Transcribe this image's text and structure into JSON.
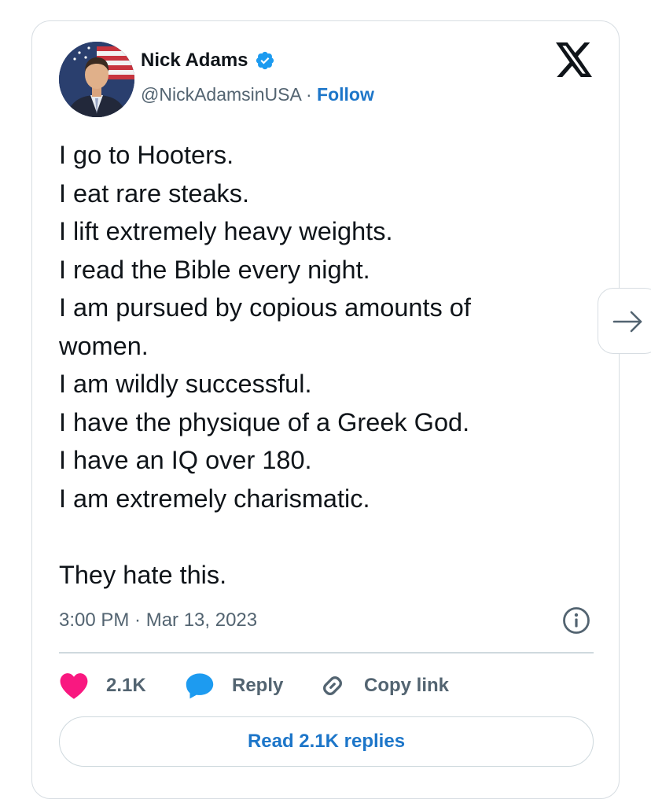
{
  "author": {
    "display_name": "Nick Adams",
    "handle": "@NickAdamsinUSA",
    "separator": "·",
    "follow_label": "Follow",
    "verified_icon": "verified-badge-icon"
  },
  "tweet": {
    "lines": [
      "I go to Hooters.",
      "I eat rare steaks.",
      "I lift extremely heavy weights.",
      "I read the Bible every night.",
      "I am pursued by copious amounts of",
      "women.",
      "I am wildly successful.",
      "I have the physique of a Greek God.",
      "I have an IQ over 180.",
      "I am extremely charismatic.",
      "",
      "They hate this."
    ],
    "timestamp": "3:00 PM · Mar 13, 2023"
  },
  "actions": {
    "like_count": "2.1K",
    "reply_label": "Reply",
    "copy_link_label": "Copy link"
  },
  "read_replies_label": "Read 2.1K replies",
  "icons": {
    "logo": "x-logo-icon",
    "info": "info-icon",
    "like": "heart-icon",
    "reply": "speech-bubble-icon",
    "copy": "link-icon",
    "next": "arrow-right-icon"
  },
  "colors": {
    "link_blue": "#1d76c9",
    "verified_blue": "#1d9bf0",
    "heart_pink": "#f91880",
    "text_secondary": "#536471"
  }
}
